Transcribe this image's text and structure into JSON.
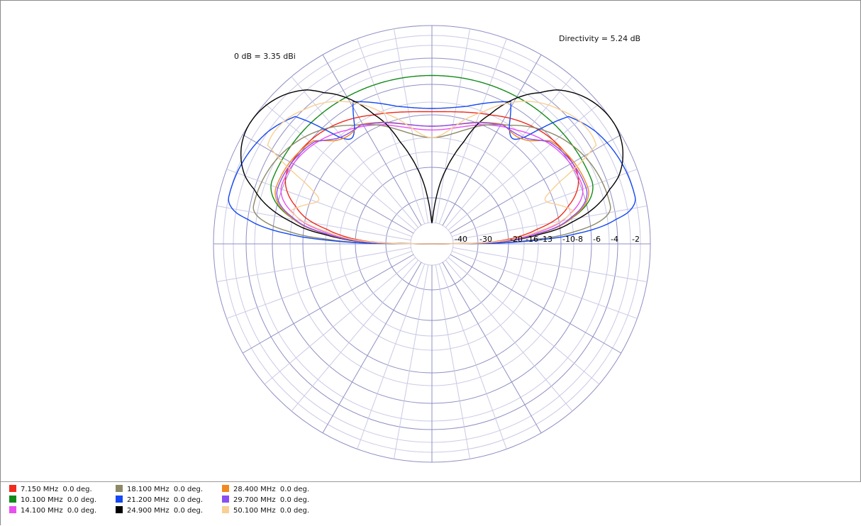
{
  "chart_data": {
    "type": "polar",
    "title": "",
    "annotations": {
      "reference": "0 dB = 3.35 dBi",
      "directivity": "Directivity = 5.24 dB"
    },
    "radial_axis": {
      "scale": "dB (nonlinear)",
      "tick_labels": [
        "-40",
        "-30",
        "-20",
        "-16",
        "-13",
        "-10",
        "-8",
        "-6",
        "-4",
        "-2"
      ],
      "major_rings_db": [
        -30,
        -20,
        -10,
        -6,
        -3,
        0
      ],
      "minor_rings_db": [
        -40,
        -16,
        -13,
        -8,
        -4,
        -2,
        -1
      ],
      "min_db": -40,
      "max_db": 0
    },
    "angular_axis": {
      "major_step_deg": 30,
      "minor_step_deg": 10,
      "grid": true
    },
    "series": [
      {
        "name": "7.150 MHz  0.0 deg.",
        "color": "#f22a1d",
        "peak_db": -5.7,
        "null_db": -9.5,
        "lobe_deg": 28,
        "ripple": 0.0,
        "ripple_deg": 60
      },
      {
        "name": "10.100 MHz  0.0 deg.",
        "color": "#128a1a",
        "peak_db": -4.6,
        "null_db": -5.0,
        "lobe_deg": 22,
        "ripple": 0.0,
        "ripple_deg": 60
      },
      {
        "name": "14.100 MHz  0.0 deg.",
        "color": "#ea4ff0",
        "peak_db": -5.8,
        "null_db": -12.0,
        "lobe_deg": 22,
        "ripple": 0.0,
        "ripple_deg": 60
      },
      {
        "name": "18.100 MHz  0.0 deg.",
        "color": "#8c8967",
        "peak_db": -3.4,
        "null_db": -13.0,
        "lobe_deg": 12,
        "ripple": 0.0,
        "ripple_deg": 60
      },
      {
        "name": "21.200 MHz  0.0 deg.",
        "color": "#1548f2",
        "peak_db": -1.0,
        "null_db": -9.0,
        "lobe_deg": 13,
        "ripple": 0.45,
        "ripple_deg": 52
      },
      {
        "name": "24.900 MHz  0.0 deg.",
        "color": "#000000",
        "peak_db": 0.0,
        "null_db": -40.0,
        "lobe_deg": 34,
        "ripple": 0.0,
        "ripple_deg": 60
      },
      {
        "name": "28.400 MHz  0.0 deg.",
        "color": "#f08a1e",
        "peak_db": -5.3,
        "null_db": -11.5,
        "lobe_deg": 20,
        "ripple": 0.15,
        "ripple_deg": 50
      },
      {
        "name": "29.700 MHz  0.0 deg.",
        "color": "#8a4ff2",
        "peak_db": -5.5,
        "null_db": -11.5,
        "lobe_deg": 20,
        "ripple": 0.1,
        "ripple_deg": 50
      },
      {
        "name": "50.100 MHz  0.0 deg.",
        "color": "#f9cf94",
        "peak_db": -2.4,
        "null_db": -13.0,
        "lobe_deg": 35,
        "ripple": 0.55,
        "ripple_deg": 22
      }
    ]
  }
}
